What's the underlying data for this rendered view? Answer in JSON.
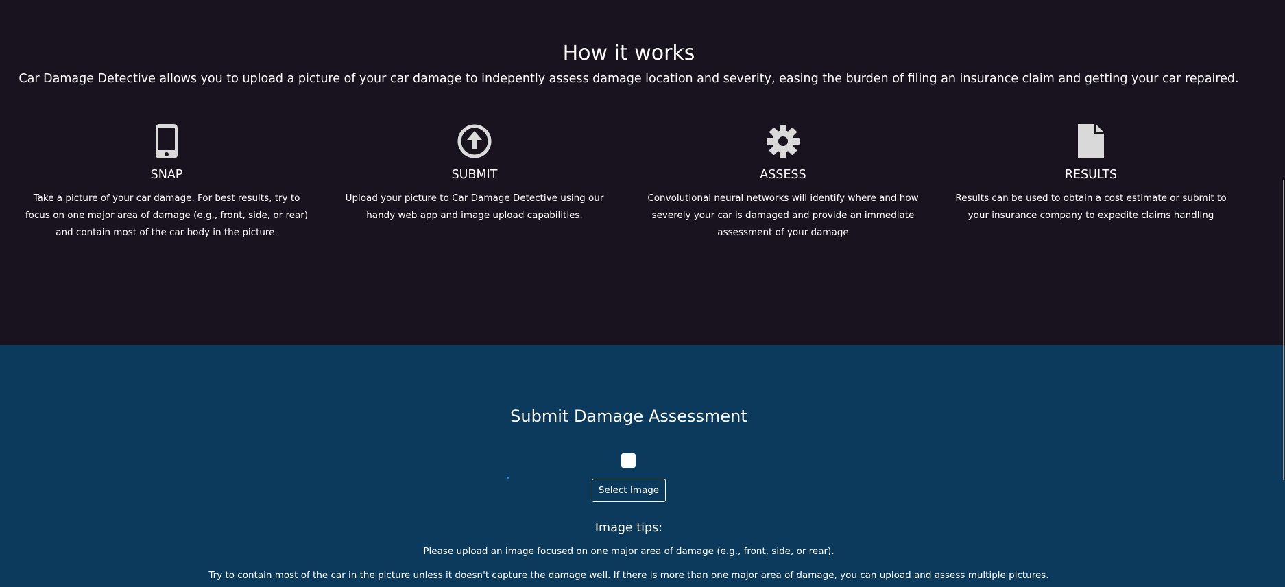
{
  "how": {
    "title": "How it works",
    "subtitle": "Car Damage Detective allows you to upload a picture of your car damage to indepently assess damage location and severity, easing the burden of filing an insurance claim and getting your car repaired.",
    "features": [
      {
        "icon": "mobile-phone-icon",
        "name": "SNAP",
        "desc": "Take a picture of your car damage. For best results, try to focus on one major area of damage (e.g., front, side, or rear) and contain most of the car body in the picture."
      },
      {
        "icon": "upload-circle-icon",
        "name": "SUBMIT",
        "desc": "Upload your picture to Car Damage Detective using our handy web app and image upload capabilities."
      },
      {
        "icon": "gear-icon",
        "name": "ASSESS",
        "desc": "Convolutional neural networks will identify where and how severely your car is damaged and provide an immediate assessment of your damage"
      },
      {
        "icon": "document-icon",
        "name": "RESULTS",
        "desc": "Results can be used to obtain a cost estimate or submit to your insurance company to expedite claims handling"
      }
    ]
  },
  "submit": {
    "title": "Submit Damage Assessment",
    "select_label": "Select Image",
    "tips_title": "Image tips:",
    "tips": [
      "Please upload an image focused on one major area of damage (e.g., front, side, or rear).",
      "Try to contain most of the car in the picture unless it doesn't capture the damage well. If there is more than one major area of damage, you can upload and assess multiple pictures."
    ]
  },
  "colors": {
    "top_background": "#18131f",
    "bottom_background": "#0b3a5c",
    "icon_color": "#d9d9d9",
    "text": "#ffffff"
  }
}
